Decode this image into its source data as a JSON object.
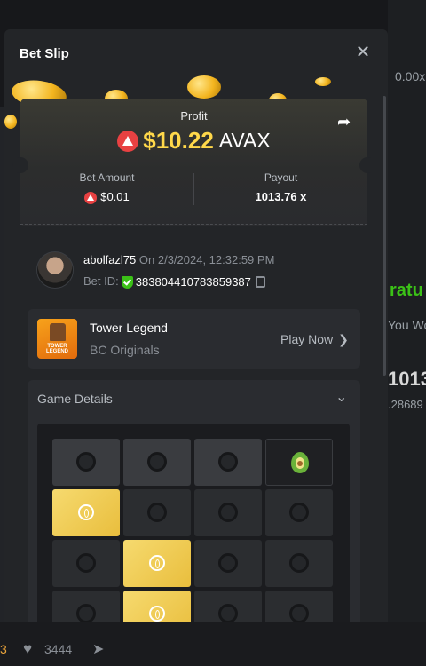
{
  "background": {
    "right_texts": [
      "0.00x",
      "ratu",
      "You Wo",
      "1013",
      ".28689"
    ],
    "bottom": {
      "orange_count": "3",
      "likes": "3444"
    }
  },
  "modal": {
    "title": "Bet Slip",
    "close_icon": "close-icon",
    "profit": {
      "label": "Profit",
      "amount": "$10.22",
      "currency": "AVAX",
      "share_icon": "share-icon"
    },
    "bet_amount": {
      "label": "Bet Amount",
      "value": "$0.01"
    },
    "payout": {
      "label": "Payout",
      "value": "1013.76 x"
    },
    "user": {
      "name": "abolfazl75",
      "date": "On 2/3/2024, 12:32:59 PM",
      "bet_id_label": "Bet ID:",
      "bet_id": "383804410783859387"
    },
    "game": {
      "name": "Tower Legend",
      "provider": "BC Originals",
      "thumb_text": "TOWER LEGEND",
      "play_label": "Play Now"
    },
    "details_label": "Game Details",
    "board": {
      "rows": [
        [
          "closed",
          "closed",
          "closed",
          "avocado"
        ],
        [
          "gold",
          "dark",
          "dark",
          "dark"
        ],
        [
          "dark",
          "gold",
          "dark",
          "dark"
        ],
        [
          "dark",
          "gold",
          "dark",
          "dark"
        ]
      ]
    }
  },
  "colors": {
    "accent_gold": "#ffd84a",
    "avax_red": "#e84142",
    "verified_green": "#3bc117"
  }
}
